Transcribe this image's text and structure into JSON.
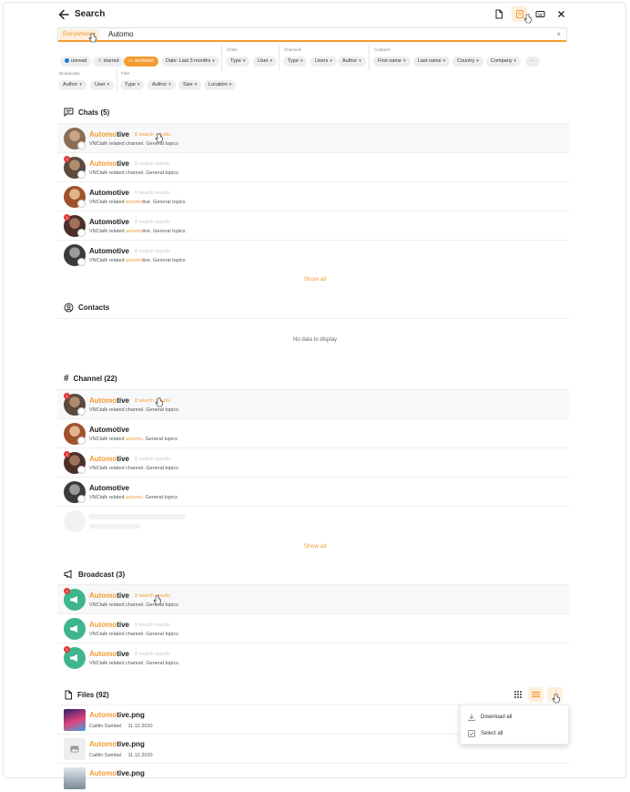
{
  "header": {
    "title": "Search",
    "icons": [
      "back-arrow-icon",
      "document-icon",
      "archive-icon",
      "keyboard-icon",
      "close-icon"
    ]
  },
  "search": {
    "scope": "Everywhere",
    "query": "Automo",
    "clear": "×"
  },
  "filters": {
    "quick": {
      "unread": "unread",
      "starred": "starred",
      "archived": "archived",
      "date": "Date: Last 3 months"
    },
    "chats": {
      "label": "Chats",
      "type": "Type",
      "user": "User"
    },
    "channels": {
      "label": "Channels",
      "type": "Type",
      "users": "Users",
      "author": "Author"
    },
    "contacts": {
      "label": "Contacts",
      "first_name": "First name",
      "last_name": "Last name",
      "country": "Country",
      "company": "Company",
      "more": "···"
    },
    "broadcasts": {
      "label": "Broadcasts",
      "author": "Author",
      "user": "User"
    },
    "files": {
      "label": "Files",
      "type": "Type",
      "author": "Author",
      "size": "Size",
      "location": "Location"
    }
  },
  "chats": {
    "title": "Chats (5)",
    "items": [
      {
        "hl": "Automo",
        "rest": "tive",
        "count": "8 search results",
        "sub_pre": "VNCtalk related channel. General topics",
        "sub_hl": "",
        "sub_post": ""
      },
      {
        "hl": "Automo",
        "rest": "tive",
        "count": "8 search results",
        "sub_pre": "VNCtalk related channel. General topics",
        "sub_hl": "",
        "sub_post": "",
        "badge": "1"
      },
      {
        "hl": "",
        "rest": "Automotive",
        "count": "8 search results",
        "sub_pre": "VNCtalk related ",
        "sub_hl": "automo",
        "sub_post": "tive. General topics"
      },
      {
        "hl": "",
        "rest": "Automotive",
        "count": "8 search results",
        "sub_pre": "VNCtalk related ",
        "sub_hl": "automo",
        "sub_post": "tive. General topics",
        "badge": "1"
      },
      {
        "hl": "",
        "rest": "Automotive",
        "count": "8 search results",
        "sub_pre": "VNCtalk related ",
        "sub_hl": "automo",
        "sub_post": "tive. General topics"
      }
    ],
    "show_all": "Show all"
  },
  "contacts": {
    "title": "Contacts",
    "empty": "No data to display"
  },
  "channels": {
    "title": "Channel (22)",
    "items": [
      {
        "hl": "Automo",
        "rest": "tive",
        "count": "8 search results",
        "sub_pre": "VNCtalk related channel. General topics",
        "sub_hl": "",
        "sub_post": "",
        "badge": "1"
      },
      {
        "hl": "",
        "rest": "Automotive",
        "count": "",
        "sub_pre": "VNCtalk related ",
        "sub_hl": "automo",
        "sub_post": ". General topics"
      },
      {
        "hl": "Automo",
        "rest": "tive",
        "count": "8 search results",
        "sub_pre": "VNCtalk related channel. General topics",
        "sub_hl": "",
        "sub_post": "",
        "badge": "1"
      },
      {
        "hl": "",
        "rest": "Automotive",
        "count": "",
        "sub_pre": "VNCtalk related ",
        "sub_hl": "automo",
        "sub_post": ". General topics"
      }
    ],
    "show_all": "Show all"
  },
  "broadcasts": {
    "title": "Broadcast (3)",
    "items": [
      {
        "hl": "Automo",
        "rest": "tive",
        "count": "8 search results",
        "sub_pre": "VNCtalk related channel. General topics",
        "badge": "1"
      },
      {
        "hl": "Automo",
        "rest": "tive",
        "count": "8 search results",
        "sub_pre": "VNCtalk related channel. General topics"
      },
      {
        "hl": "Automo",
        "rest": "tive",
        "count": "8 search results",
        "sub_pre": "VNCtalk related channel. General topics",
        "badge": "1"
      }
    ]
  },
  "files": {
    "title": "Files (92)",
    "items": [
      {
        "hl": "Automo",
        "rest": "tive.png",
        "author": "Caitlin Sambel",
        "date": "11.12.2020"
      },
      {
        "hl": "Automo",
        "rest": "tive.png",
        "author": "Caitlin Sambel",
        "date": "11.12.2020"
      },
      {
        "hl": "Automo",
        "rest": "tive.png",
        "author": "",
        "date": ""
      }
    ],
    "menu": {
      "download_all": "Download all",
      "select_all": "Select all"
    }
  },
  "colors": {
    "accent": "#f39c32",
    "unread_dot": "#1f7ae0",
    "badge": "#e03a3a",
    "broadcast": "#3fb58c"
  }
}
